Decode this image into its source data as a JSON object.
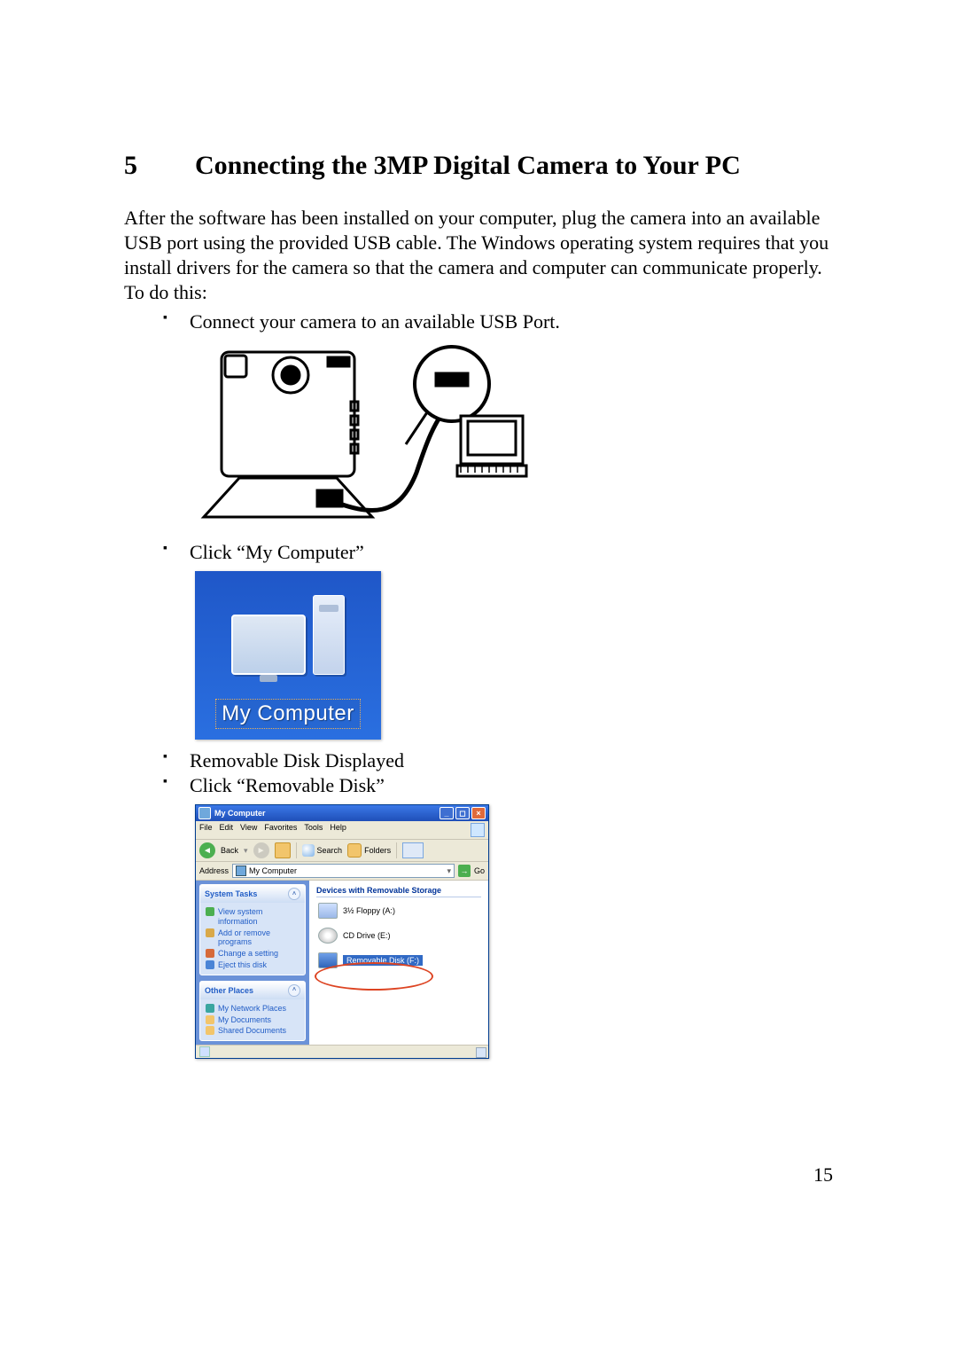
{
  "section": {
    "number": "5",
    "title": "Connecting the 3MP Digital Camera to Your PC"
  },
  "intro": "After the software has been installed on your computer, plug the camera into an available USB port using the provided USB cable.  The Windows operating system requires that you install drivers for the camera so that the camera and computer can communicate properly.   To do this:",
  "bullets": {
    "b1": "Connect your camera to an available USB Port.",
    "b2": "Click “My Computer”",
    "b3": "Removable Disk Displayed",
    "b4": "Click “Removable Disk”"
  },
  "mycomputer": {
    "label": "My Computer"
  },
  "explorer": {
    "title": "My Computer",
    "menu": {
      "file": "File",
      "edit": "Edit",
      "view": "View",
      "favorites": "Favorites",
      "tools": "Tools",
      "help": "Help"
    },
    "toolbar": {
      "back": "Back",
      "search": "Search",
      "folders": "Folders"
    },
    "address": {
      "label": "Address",
      "value": "My Computer",
      "go": "Go"
    },
    "panes": {
      "system": {
        "title": "System Tasks",
        "items": {
          "i1": "View system information",
          "i2": "Add or remove programs",
          "i3": "Change a setting",
          "i4": "Eject this disk"
        }
      },
      "other": {
        "title": "Other Places",
        "items": {
          "i1": "My Network Places",
          "i2": "My Documents",
          "i3": "Shared Documents"
        }
      }
    },
    "content": {
      "group": "Devices with Removable Storage",
      "floppy": "3½ Floppy (A:)",
      "cd": "CD Drive (E:)",
      "removable": "Removable Disk (F:)"
    }
  },
  "page_number": "15"
}
